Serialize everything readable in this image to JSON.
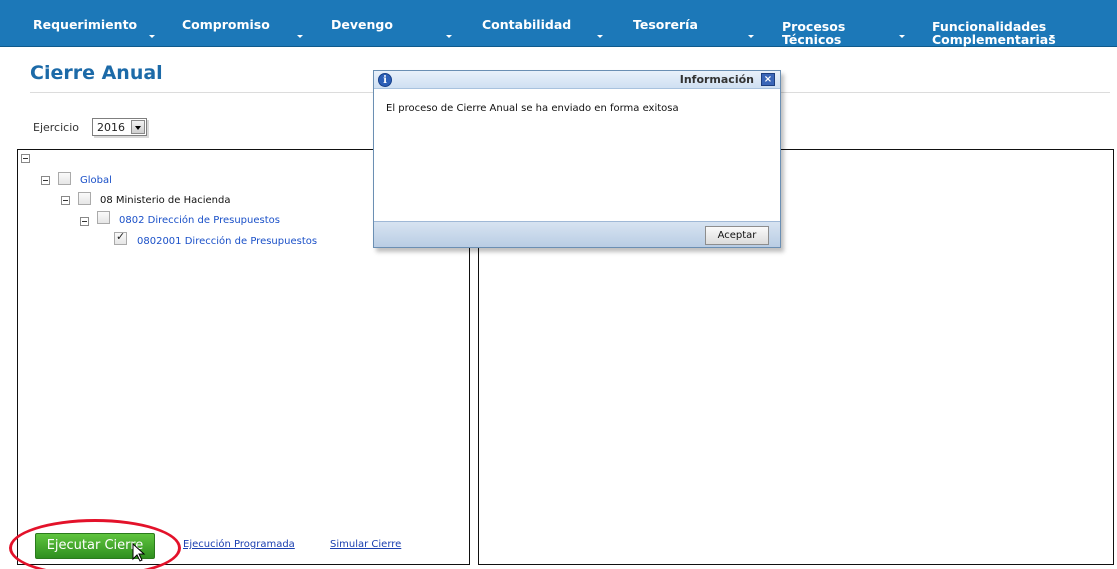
{
  "nav": {
    "items": [
      {
        "label": "Requerimiento"
      },
      {
        "label": "Compromiso"
      },
      {
        "label": "Devengo"
      },
      {
        "label": "Contabilidad"
      },
      {
        "label": "Tesorería"
      },
      {
        "label_l1": "Procesos",
        "label_l2": "Técnicos"
      },
      {
        "label_l1": "Funcionalidades",
        "label_l2": "Complementarias"
      }
    ]
  },
  "page": {
    "title": "Cierre Anual"
  },
  "ejercicio": {
    "label": "Ejercicio",
    "selected": "2016"
  },
  "tree": {
    "nodes": [
      {
        "label": "Global",
        "checked": false,
        "style": "link"
      },
      {
        "label": "08 Ministerio de Hacienda",
        "checked": false,
        "style": "plain"
      },
      {
        "label": "0802 Dirección de Presupuestos",
        "checked": false,
        "style": "link"
      },
      {
        "label": "0802001 Dirección de Presupuestos",
        "checked": true,
        "style": "link"
      }
    ]
  },
  "actions": {
    "execute_label": "Ejecutar Cierre",
    "scheduled_label": "Ejecución Programada",
    "simulate_label": "Simular Cierre"
  },
  "dialog": {
    "title": "Información",
    "info_icon_glyph": "i",
    "close_glyph": "×",
    "message": "El proceso de Cierre Anual se ha enviado en forma exitosa",
    "accept_label": "Aceptar"
  },
  "colors": {
    "nav_bg": "#1c78b8",
    "title": "#1c6aa8",
    "execute_button": "#3fa82a",
    "highlight_oval": "#e3122a",
    "link": "#1a50c8"
  }
}
